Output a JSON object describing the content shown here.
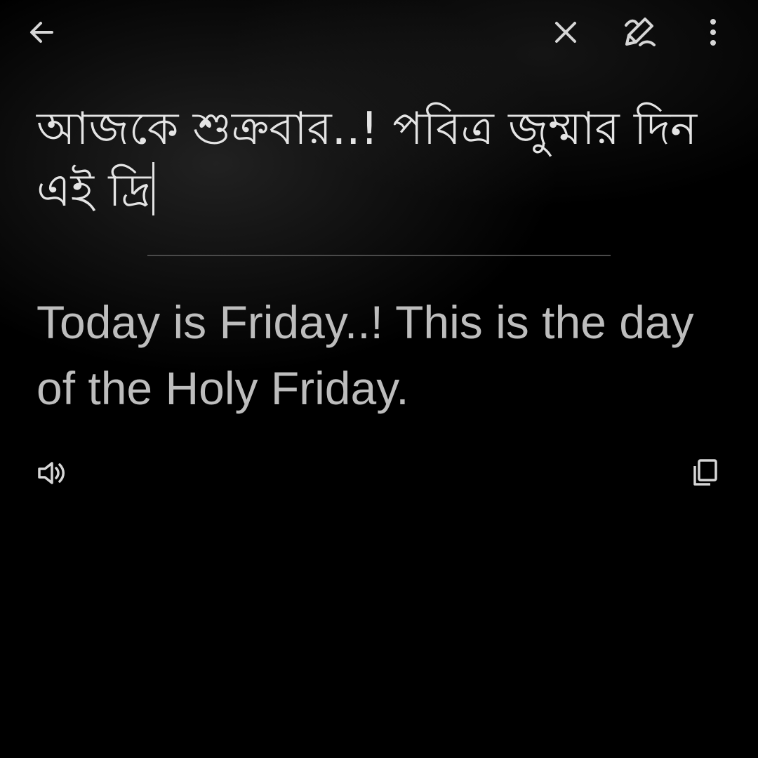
{
  "toolbar": {
    "back_icon": "arrow-left-icon",
    "clear_icon": "close-icon",
    "handwriting_icon": "handwriting-pen-icon",
    "more_icon": "more-vertical-icon"
  },
  "input": {
    "source_text": "আজকে শুক্রবার..! পবিত্র জুম্মার দিন এই দ্রি"
  },
  "translation": {
    "text": "Today is Friday..! This is the day of the Holy Friday.",
    "speak_icon": "volume-icon",
    "copy_icon": "copy-icon"
  },
  "colors": {
    "background": "#000000",
    "source_text": "#e4e4e4",
    "translation_text": "#bdbdbd",
    "icon": "#d6d6d6",
    "divider": "#4a4a4a"
  }
}
